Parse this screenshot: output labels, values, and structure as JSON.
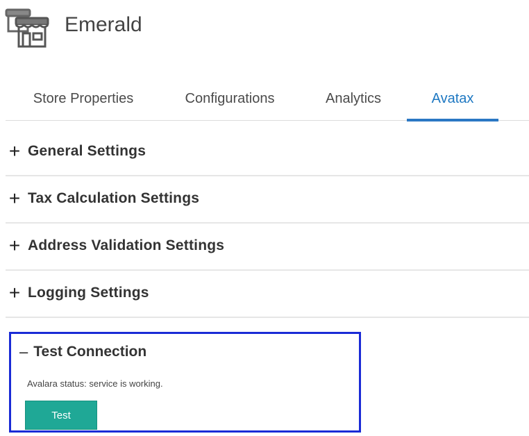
{
  "store": {
    "name": "Emerald",
    "icon": "store-icon"
  },
  "tabs": [
    {
      "label": "Store Properties",
      "active": false
    },
    {
      "label": "Configurations",
      "active": false
    },
    {
      "label": "Analytics",
      "active": false
    },
    {
      "label": "Avatax",
      "active": true
    }
  ],
  "accordion": [
    {
      "title": "General Settings",
      "expanded": false,
      "icon": "plus-icon"
    },
    {
      "title": "Tax Calculation Settings",
      "expanded": false,
      "icon": "plus-icon"
    },
    {
      "title": "Address Validation Settings",
      "expanded": false,
      "icon": "plus-icon"
    },
    {
      "title": "Logging Settings",
      "expanded": false,
      "icon": "plus-icon"
    }
  ],
  "test_connection": {
    "title": "Test Connection",
    "expanded": true,
    "icon": "minus-icon",
    "status": "Avalara status: service is working.",
    "button_label": "Test"
  },
  "colors": {
    "active_tab": "#1e78c2",
    "button": "#1fa896",
    "highlight_border": "#1a2bd6"
  }
}
